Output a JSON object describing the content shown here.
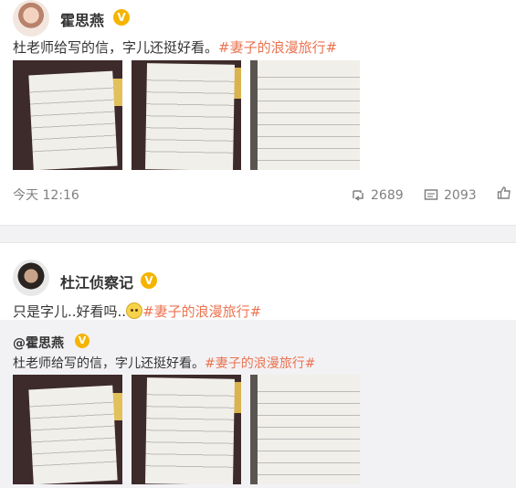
{
  "post1": {
    "author": "霍思燕",
    "verified_badge": "V",
    "text": "杜老师给写的信，字儿还挺好看。",
    "hashtag": "#妻子的浪漫旅行#",
    "time": "今天 12:16",
    "repost_count": "2689",
    "comment_count": "2093",
    "icons": {
      "repost": "repost-icon",
      "comment": "comment-icon",
      "like": "like-icon"
    },
    "photos": [
      "handwritten-letter-photo-1",
      "handwritten-letter-photo-2",
      "handwritten-letter-photo-3"
    ]
  },
  "post2": {
    "author": "杜江侦察记",
    "verified_badge": "V",
    "text": "只是字儿..好看吗..",
    "hashtag": "#妻子的浪漫旅行#",
    "emoji": "emoji-face-icon",
    "quoted": {
      "author": "@霍思燕",
      "verified_badge": "V",
      "text": "杜老师给写的信，字儿还挺好看。",
      "hashtag": "#妻子的浪漫旅行#",
      "photos": [
        "handwritten-letter-photo-1",
        "handwritten-letter-photo-2",
        "handwritten-letter-photo-3"
      ]
    }
  },
  "colors": {
    "hashtag": "#eb7350",
    "badge": "#f5b400",
    "divider": "#f2f2f5",
    "meta": "#808080"
  }
}
